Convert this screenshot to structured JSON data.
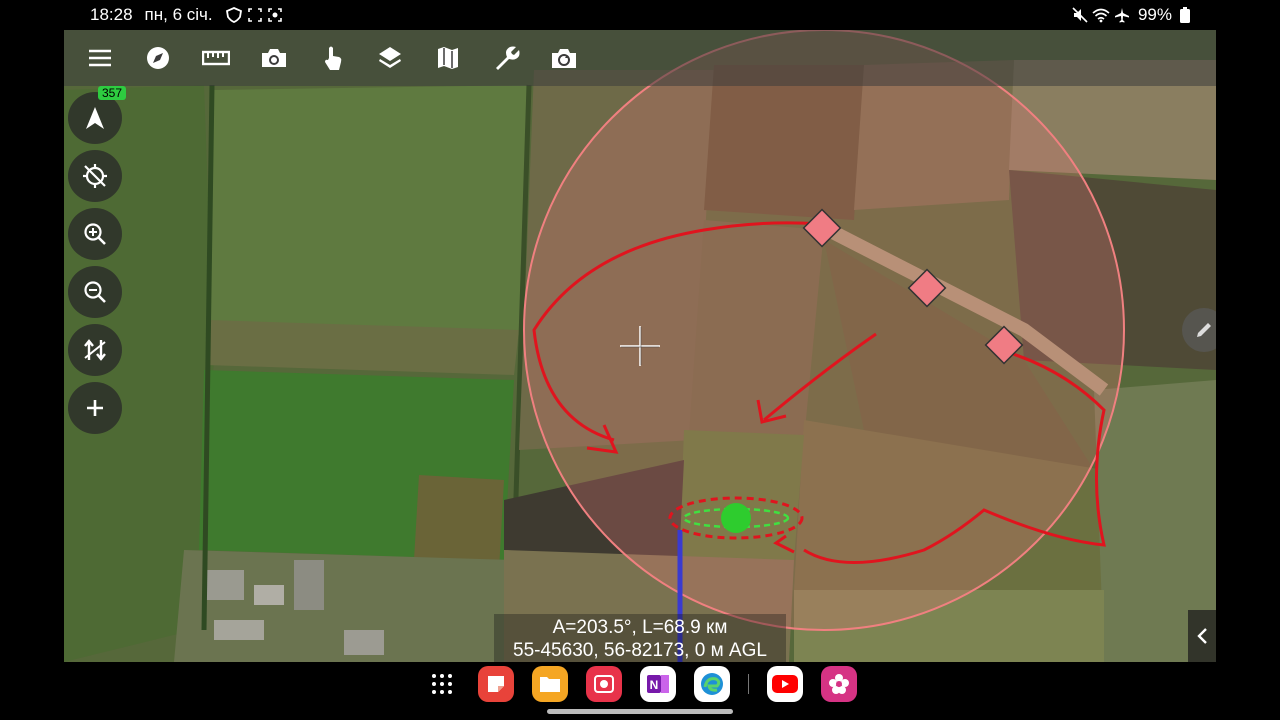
{
  "status_bar": {
    "time": "18:28",
    "date": "пн, 6 січ.",
    "battery": "99%"
  },
  "toolbar": {
    "items": [
      "menu-icon",
      "compass-icon",
      "ruler-icon",
      "camera-icon",
      "touch-icon",
      "layers-icon",
      "map-icon",
      "wrench-icon",
      "camera-rotate-icon"
    ]
  },
  "side": {
    "heading_badge": "357"
  },
  "readout": {
    "line1": "A=203.5°, L=68.9 км",
    "line2": "55-45630, 56-82173, 0 м AGL"
  },
  "dock": {
    "apps": [
      "apps-grid-icon",
      "sticky-notes-app",
      "files-app",
      "gallery-app",
      "onenote-app",
      "edge-app",
      "youtube-app",
      "blossom-app"
    ]
  },
  "colors": {
    "route": "#e0141e",
    "waypoint": "#f07c84",
    "range_circle": "#f08080",
    "drone": "#2ecc2e",
    "badge": "#2ecc40"
  }
}
